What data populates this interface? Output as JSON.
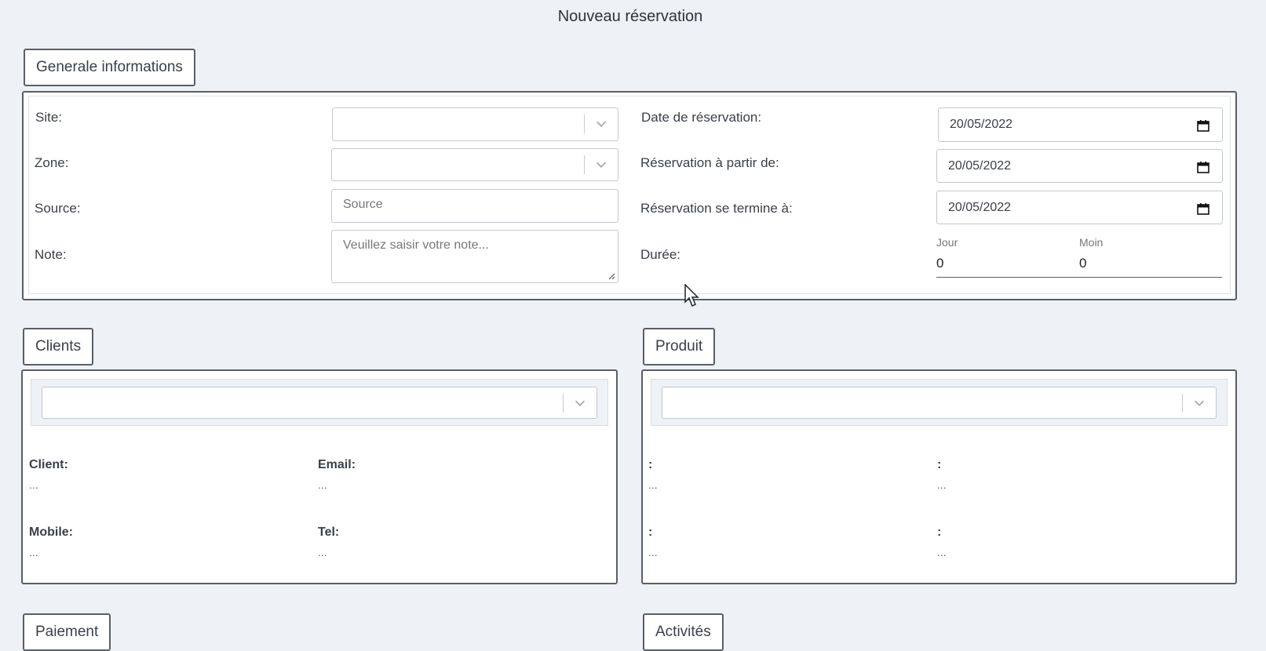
{
  "page": {
    "title": "Nouveau réservation"
  },
  "general": {
    "legend": "Generale informations",
    "site_label": "Site:",
    "zone_label": "Zone:",
    "source_label": "Source:",
    "source_placeholder": "Source",
    "note_label": "Note:",
    "note_placeholder": "Veuillez saisir votre note...",
    "date_label": "Date de réservation:",
    "date_value": "20/05/2022",
    "from_label": "Réservation à partir de:",
    "from_value": "20/05/2022",
    "to_label": "Réservation se termine à:",
    "to_value": "20/05/2022",
    "duration_label": "Durée:",
    "day_label": "Jour",
    "day_value": "0",
    "month_label": "Moin",
    "month_value": "0"
  },
  "clients": {
    "legend": "Clients",
    "client_label": "Client:",
    "client_value": "...",
    "email_label": "Email:",
    "email_value": "...",
    "mobile_label": "Mobile:",
    "mobile_value": "...",
    "tel_label": "Tel:",
    "tel_value": "..."
  },
  "produit": {
    "legend": "Produit",
    "f1_label": ":",
    "f1_value": "...",
    "f2_label": ":",
    "f2_value": "...",
    "f3_label": ":",
    "f3_value": "...",
    "f4_label": ":",
    "f4_value": "..."
  },
  "paiement": {
    "legend": "Paiement"
  },
  "activites": {
    "legend": "Activités"
  },
  "icons": {
    "chevron": "chevron-down-icon",
    "calendar": "calendar-icon",
    "cursor": "mouse-pointer-icon"
  }
}
